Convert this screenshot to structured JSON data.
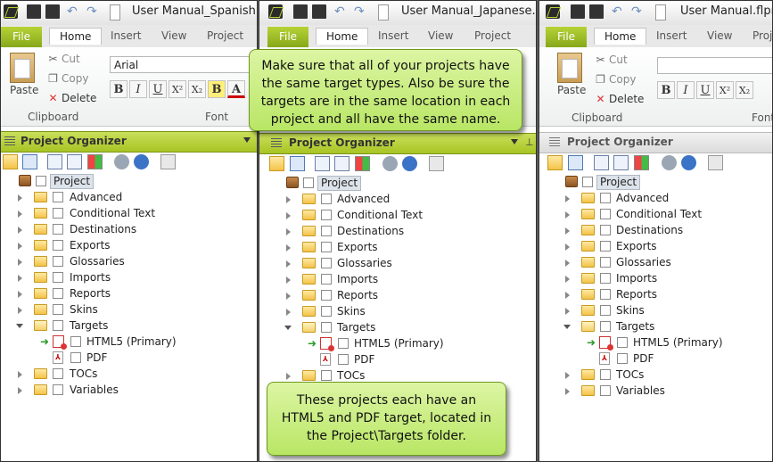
{
  "ribbon": {
    "file_tab": "File",
    "tabs": [
      "Home",
      "Insert",
      "View",
      "Project"
    ],
    "clipboard": {
      "paste": "Paste",
      "cut": "Cut",
      "copy": "Copy",
      "delete": "Delete",
      "group": "Clipboard"
    },
    "font": {
      "name": "Arial",
      "group": "Font",
      "buttons": [
        "B",
        "I",
        "U",
        "X²",
        "X₂",
        "B",
        "A"
      ]
    }
  },
  "panes": [
    {
      "title": "User Manual_Spanish.flprj",
      "font_value": "Arial"
    },
    {
      "title": "User Manual_Japanese.flprj",
      "font_value": ""
    },
    {
      "title": "User Manual.flprj",
      "font_value": ""
    }
  ],
  "organizer": {
    "title": "Project Organizer",
    "root": "Project",
    "folders": [
      "Advanced",
      "Conditional Text",
      "Destinations",
      "Exports",
      "Glossaries",
      "Imports",
      "Reports",
      "Skins",
      "Targets"
    ],
    "targets": [
      "HTML5 (Primary)",
      "PDF"
    ],
    "after": [
      "TOCs",
      "Variables"
    ]
  },
  "callouts": {
    "top": "Make sure that all of your projects have the same target types. Also be sure the targets are in the same location in each project and all have the same name.",
    "bottom": "These projects each have an HTML5 and PDF target, located in the Project\\Targets folder."
  },
  "colors": {
    "accent": "#a8c424",
    "callout": "#c5eb7f"
  }
}
